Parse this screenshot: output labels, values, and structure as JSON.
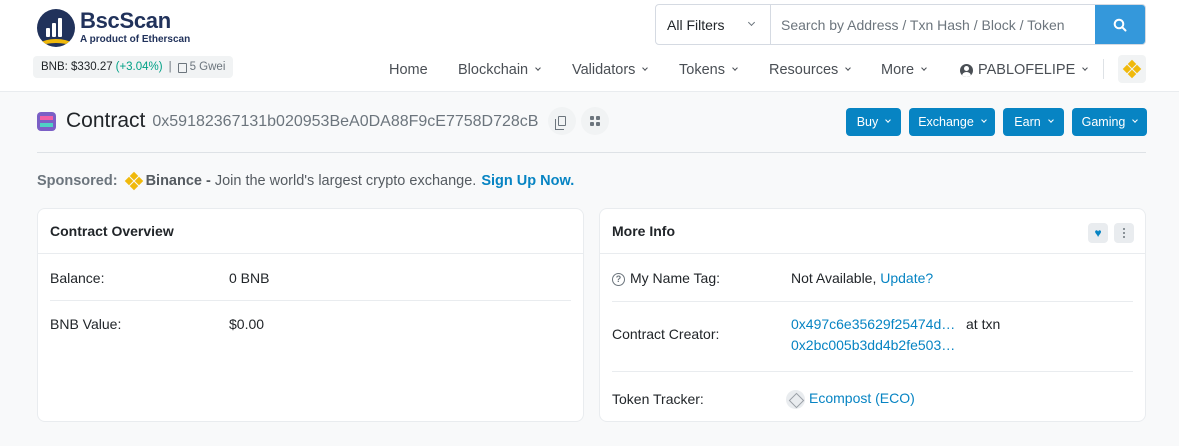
{
  "brand": {
    "name": "BscScan",
    "subtitle": "A product of Etherscan"
  },
  "ticker": {
    "price": "BNB: $330.27",
    "change": "(+3.04%)",
    "separator": "|",
    "gas": "5 Gwei"
  },
  "search": {
    "filter": "All Filters",
    "placeholder": "Search by Address / Txn Hash / Block / Token"
  },
  "nav": {
    "home": "Home",
    "blockchain": "Blockchain",
    "validators": "Validators",
    "tokens": "Tokens",
    "resources": "Resources",
    "more": "More",
    "user": "PABLOFELIPE"
  },
  "contract": {
    "label": "Contract",
    "address": "0x59182367131b020953BeA0DA88F9cE7758D728cB"
  },
  "actions": {
    "buy": "Buy",
    "exchange": "Exchange",
    "earn": "Earn",
    "gaming": "Gaming"
  },
  "sponsor": {
    "label": "Sponsored:",
    "brand": "Binance -",
    "text": "Join the world's largest crypto exchange.",
    "cta": "Sign Up Now."
  },
  "overview": {
    "title": "Contract Overview",
    "balance_label": "Balance:",
    "balance_value": "0 BNB",
    "value_label": "BNB Value:",
    "value_value": "$0.00"
  },
  "more_info": {
    "title": "More Info",
    "name_tag_label": "My Name Tag:",
    "name_tag_value": "Not Available,",
    "name_tag_link": "Update?",
    "creator_label": "Contract Creator:",
    "creator_address": "0x497c6e35629f25474d…",
    "creator_at": "at txn",
    "creator_txn": "0x2bc005b3dd4b2fe503…",
    "tracker_label": "Token Tracker:",
    "tracker_value": "Ecompost (ECO)"
  },
  "colors": {
    "primary": "#0784c3",
    "search_button": "#3498db",
    "positive": "#00a186",
    "bnb": "#f0b90b",
    "brand_dark": "#21325b"
  }
}
